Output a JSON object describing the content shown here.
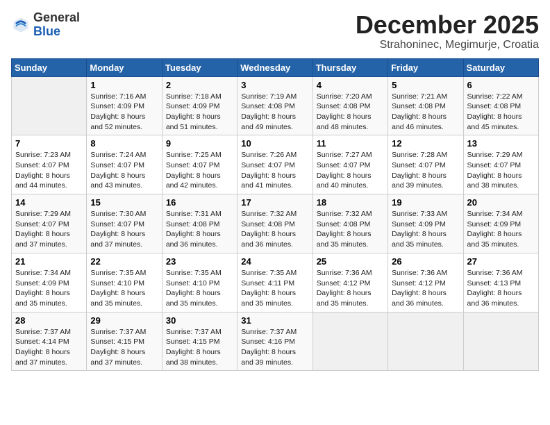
{
  "header": {
    "logo": {
      "general": "General",
      "blue": "Blue"
    },
    "title": "December 2025",
    "location": "Strahoninec, Megimurje, Croatia"
  },
  "calendar": {
    "days_of_week": [
      "Sunday",
      "Monday",
      "Tuesday",
      "Wednesday",
      "Thursday",
      "Friday",
      "Saturday"
    ],
    "weeks": [
      [
        {
          "day": "",
          "info": ""
        },
        {
          "day": "1",
          "info": "Sunrise: 7:16 AM\nSunset: 4:09 PM\nDaylight: 8 hours\nand 52 minutes."
        },
        {
          "day": "2",
          "info": "Sunrise: 7:18 AM\nSunset: 4:09 PM\nDaylight: 8 hours\nand 51 minutes."
        },
        {
          "day": "3",
          "info": "Sunrise: 7:19 AM\nSunset: 4:08 PM\nDaylight: 8 hours\nand 49 minutes."
        },
        {
          "day": "4",
          "info": "Sunrise: 7:20 AM\nSunset: 4:08 PM\nDaylight: 8 hours\nand 48 minutes."
        },
        {
          "day": "5",
          "info": "Sunrise: 7:21 AM\nSunset: 4:08 PM\nDaylight: 8 hours\nand 46 minutes."
        },
        {
          "day": "6",
          "info": "Sunrise: 7:22 AM\nSunset: 4:08 PM\nDaylight: 8 hours\nand 45 minutes."
        }
      ],
      [
        {
          "day": "7",
          "info": "Sunrise: 7:23 AM\nSunset: 4:07 PM\nDaylight: 8 hours\nand 44 minutes."
        },
        {
          "day": "8",
          "info": "Sunrise: 7:24 AM\nSunset: 4:07 PM\nDaylight: 8 hours\nand 43 minutes."
        },
        {
          "day": "9",
          "info": "Sunrise: 7:25 AM\nSunset: 4:07 PM\nDaylight: 8 hours\nand 42 minutes."
        },
        {
          "day": "10",
          "info": "Sunrise: 7:26 AM\nSunset: 4:07 PM\nDaylight: 8 hours\nand 41 minutes."
        },
        {
          "day": "11",
          "info": "Sunrise: 7:27 AM\nSunset: 4:07 PM\nDaylight: 8 hours\nand 40 minutes."
        },
        {
          "day": "12",
          "info": "Sunrise: 7:28 AM\nSunset: 4:07 PM\nDaylight: 8 hours\nand 39 minutes."
        },
        {
          "day": "13",
          "info": "Sunrise: 7:29 AM\nSunset: 4:07 PM\nDaylight: 8 hours\nand 38 minutes."
        }
      ],
      [
        {
          "day": "14",
          "info": "Sunrise: 7:29 AM\nSunset: 4:07 PM\nDaylight: 8 hours\nand 37 minutes."
        },
        {
          "day": "15",
          "info": "Sunrise: 7:30 AM\nSunset: 4:07 PM\nDaylight: 8 hours\nand 37 minutes."
        },
        {
          "day": "16",
          "info": "Sunrise: 7:31 AM\nSunset: 4:08 PM\nDaylight: 8 hours\nand 36 minutes."
        },
        {
          "day": "17",
          "info": "Sunrise: 7:32 AM\nSunset: 4:08 PM\nDaylight: 8 hours\nand 36 minutes."
        },
        {
          "day": "18",
          "info": "Sunrise: 7:32 AM\nSunset: 4:08 PM\nDaylight: 8 hours\nand 35 minutes."
        },
        {
          "day": "19",
          "info": "Sunrise: 7:33 AM\nSunset: 4:09 PM\nDaylight: 8 hours\nand 35 minutes."
        },
        {
          "day": "20",
          "info": "Sunrise: 7:34 AM\nSunset: 4:09 PM\nDaylight: 8 hours\nand 35 minutes."
        }
      ],
      [
        {
          "day": "21",
          "info": "Sunrise: 7:34 AM\nSunset: 4:09 PM\nDaylight: 8 hours\nand 35 minutes."
        },
        {
          "day": "22",
          "info": "Sunrise: 7:35 AM\nSunset: 4:10 PM\nDaylight: 8 hours\nand 35 minutes."
        },
        {
          "day": "23",
          "info": "Sunrise: 7:35 AM\nSunset: 4:10 PM\nDaylight: 8 hours\nand 35 minutes."
        },
        {
          "day": "24",
          "info": "Sunrise: 7:35 AM\nSunset: 4:11 PM\nDaylight: 8 hours\nand 35 minutes."
        },
        {
          "day": "25",
          "info": "Sunrise: 7:36 AM\nSunset: 4:12 PM\nDaylight: 8 hours\nand 35 minutes."
        },
        {
          "day": "26",
          "info": "Sunrise: 7:36 AM\nSunset: 4:12 PM\nDaylight: 8 hours\nand 36 minutes."
        },
        {
          "day": "27",
          "info": "Sunrise: 7:36 AM\nSunset: 4:13 PM\nDaylight: 8 hours\nand 36 minutes."
        }
      ],
      [
        {
          "day": "28",
          "info": "Sunrise: 7:37 AM\nSunset: 4:14 PM\nDaylight: 8 hours\nand 37 minutes."
        },
        {
          "day": "29",
          "info": "Sunrise: 7:37 AM\nSunset: 4:15 PM\nDaylight: 8 hours\nand 37 minutes."
        },
        {
          "day": "30",
          "info": "Sunrise: 7:37 AM\nSunset: 4:15 PM\nDaylight: 8 hours\nand 38 minutes."
        },
        {
          "day": "31",
          "info": "Sunrise: 7:37 AM\nSunset: 4:16 PM\nDaylight: 8 hours\nand 39 minutes."
        },
        {
          "day": "",
          "info": ""
        },
        {
          "day": "",
          "info": ""
        },
        {
          "day": "",
          "info": ""
        }
      ]
    ]
  }
}
